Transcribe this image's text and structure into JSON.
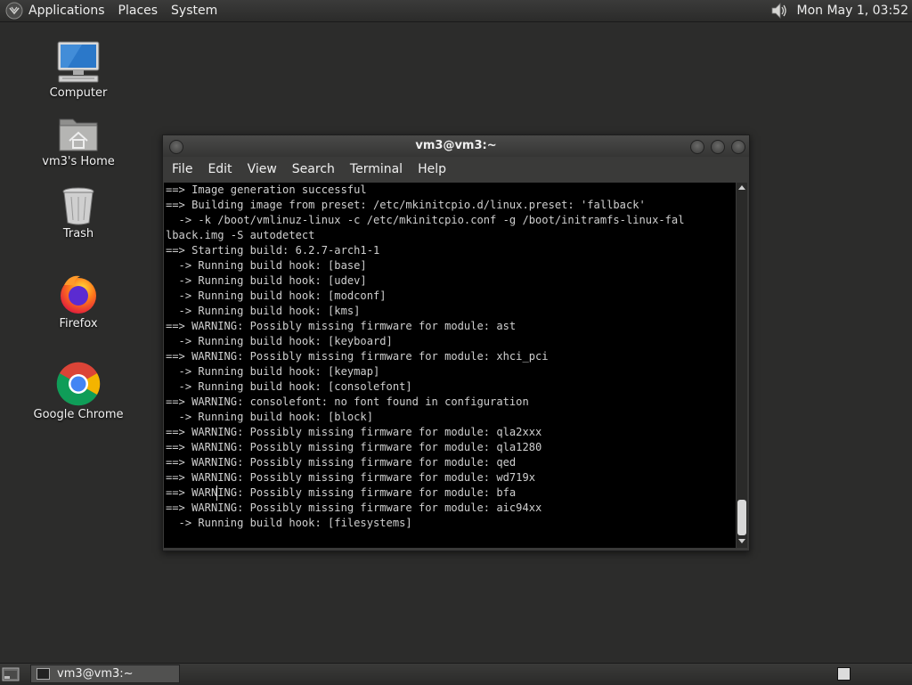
{
  "top_panel": {
    "menus": [
      "Applications",
      "Places",
      "System"
    ],
    "clock": "Mon May  1, 03:52"
  },
  "desktop": {
    "icons": [
      {
        "label": "Computer",
        "icon": "computer-icon"
      },
      {
        "label": "vm3's Home",
        "icon": "home-folder-icon"
      },
      {
        "label": "Trash",
        "icon": "trash-icon"
      },
      {
        "label": "Firefox",
        "icon": "firefox-icon"
      },
      {
        "label": "Google Chrome",
        "icon": "chrome-icon"
      }
    ]
  },
  "window": {
    "title": "vm3@vm3:~",
    "menus": [
      "File",
      "Edit",
      "View",
      "Search",
      "Terminal",
      "Help"
    ],
    "terminal_text": "==> Image generation successful\n==> Building image from preset: /etc/mkinitcpio.d/linux.preset: 'fallback'\n  -> -k /boot/vmlinuz-linux -c /etc/mkinitcpio.conf -g /boot/initramfs-linux-fal\nlback.img -S autodetect\n==> Starting build: 6.2.7-arch1-1\n  -> Running build hook: [base]\n  -> Running build hook: [udev]\n  -> Running build hook: [modconf]\n  -> Running build hook: [kms]\n==> WARNING: Possibly missing firmware for module: ast\n  -> Running build hook: [keyboard]\n==> WARNING: Possibly missing firmware for module: xhci_pci\n  -> Running build hook: [keymap]\n  -> Running build hook: [consolefont]\n==> WARNING: consolefont: no font found in configuration\n  -> Running build hook: [block]\n==> WARNING: Possibly missing firmware for module: qla2xxx\n==> WARNING: Possibly missing firmware for module: qla1280\n==> WARNING: Possibly missing firmware for module: qed\n==> WARNING: Possibly missing firmware for module: wd719x\n==> WARNING: Possibly missing firmware for module: bfa\n==> WARNING: Possibly missing firmware for module: aic94xx\n  -> Running build hook: [filesystems]"
  },
  "taskbar": {
    "task_label": "vm3@vm3:~"
  },
  "colors": {
    "desktop_bg": "#2c2c2b",
    "terminal_bg": "#000000",
    "terminal_fg": "#cfcfcf"
  }
}
